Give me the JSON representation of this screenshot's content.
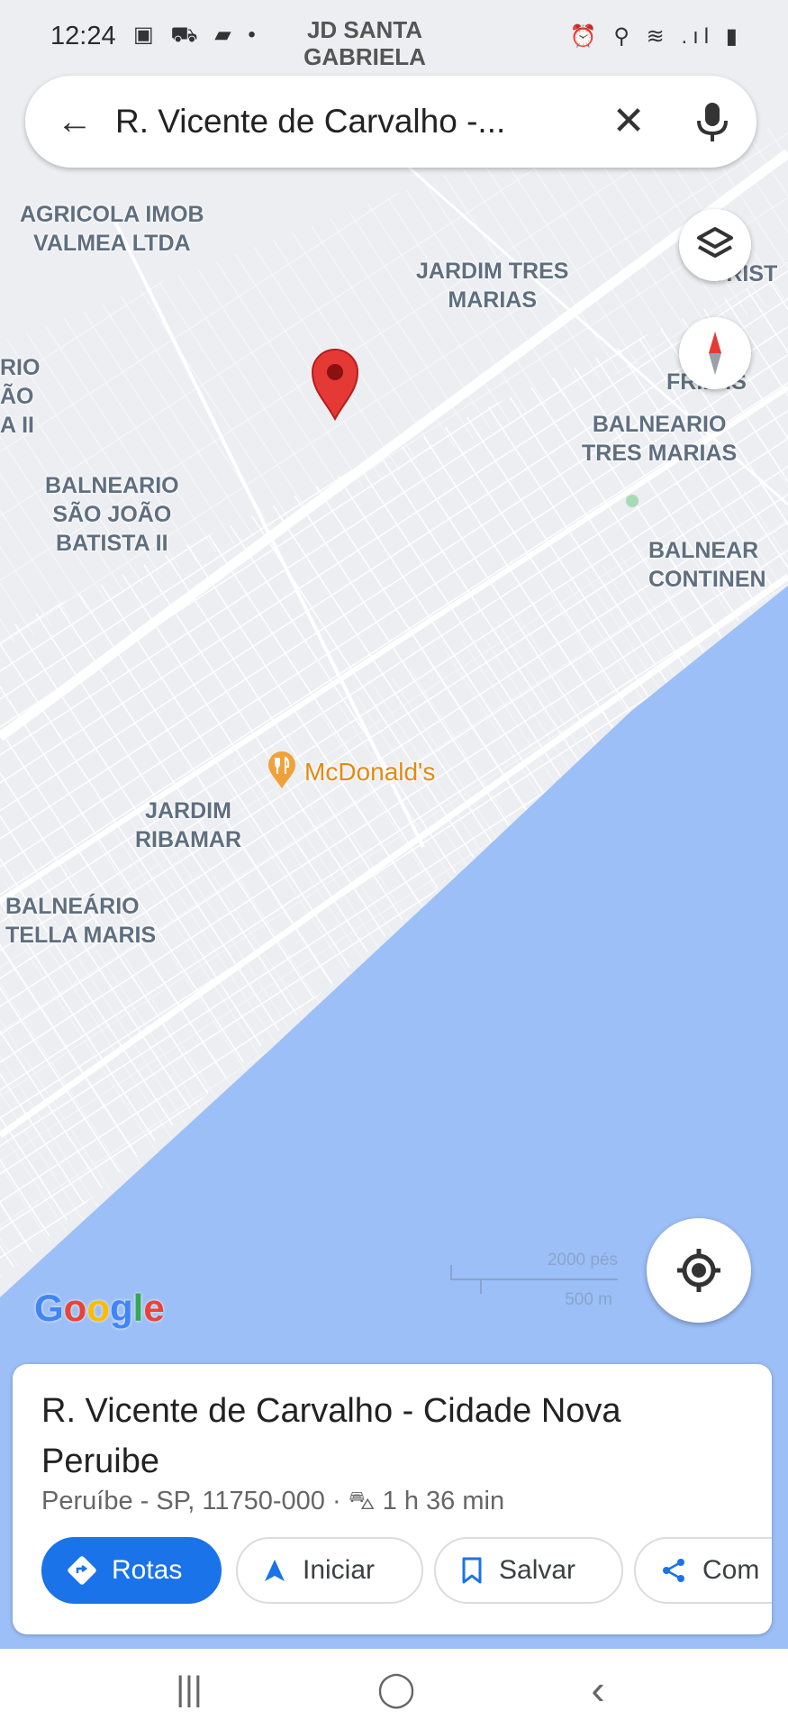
{
  "status_bar": {
    "time": "12:24",
    "left_icons": "▣ ⛟ ▰ •",
    "carrier": "JD SANTA\nGABRIELA",
    "right_icons": "⏰ ⚲ ≋ .ıl ▮"
  },
  "search": {
    "query": "R. Vicente de Carvalho -..."
  },
  "map": {
    "labels": {
      "agricola": "AGRICOLA IMOB\nVALMEA LTDA",
      "jardim_tres_marias": "JARDIM TRES\nMARIAS",
      "ro_turist": "RO\n·URIST",
      "rio_ao": "RIO\nÃO\nA II",
      "sao_francisco": "ÃO\nFR..CIS",
      "balneario_tres_marias": "BALNEARIO\nTRES MARIAS",
      "balneario_sao_joao": "BALNEARIO\nSÃO JOÃO\nBATISTA II",
      "balneario_continental": "BALNEAR\nCONTINEN",
      "jardim_ribamar": "JARDIM\nRIBAMAR",
      "balneario_stella": "BALNEÁRIO\nTELLA MARIS"
    },
    "poi": "McDonald's",
    "scale_top": "2000 pés",
    "scale_bottom": "500 m",
    "logo": "Google",
    "colors": {
      "land": "#eceef1",
      "water": "#9cbff7",
      "pin": "#e53935",
      "poi": "#e28a13",
      "accent": "#1a73e8"
    }
  },
  "place": {
    "title": "R. Vicente de Carvalho - Cidade Nova Peruibe",
    "subtitle": "Peruíbe - SP, 11750-000 · ⛍ 1 h 36 min",
    "actions": {
      "directions": "Rotas",
      "start": "Iniciar",
      "save": "Salvar",
      "share": "Com"
    }
  },
  "nav": {
    "recents": "|||",
    "home": "◯",
    "back": "‹"
  }
}
